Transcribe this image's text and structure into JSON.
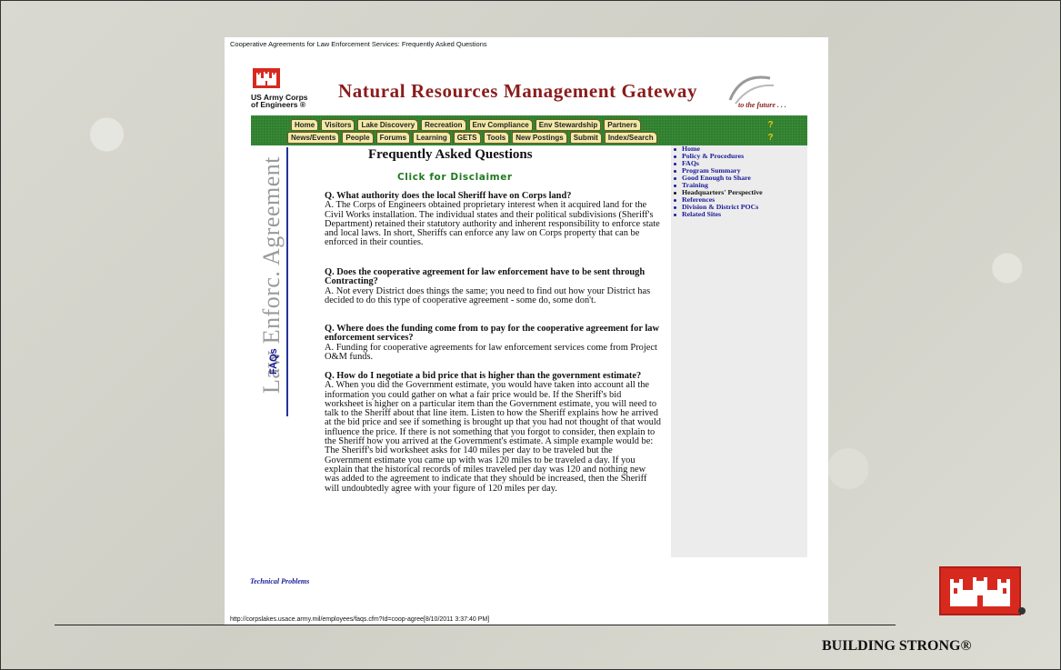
{
  "slide": {
    "footer_text": "BUILDING STRONG®"
  },
  "page": {
    "caption": "Cooperative Agreements for Law Enforcement Services: Frequently Asked Questions",
    "url_line": "http://corpslakes.usace.army.mil/employees/faqs.cfm?Id=coop-agree[8/10/2011 3:37:40 PM]",
    "org_name": "US Army Corps of Engineers ®",
    "site_title": "Natural Resources Management Gateway",
    "tagline": "to the future . . .",
    "nav_row1": [
      "Home",
      "Visitors",
      "Lake Discovery",
      "Recreation",
      "Env Compliance",
      "Env Stewardship",
      "Partners"
    ],
    "nav_row2": [
      "News/Events",
      "People",
      "Forums",
      "Learning",
      "GETS",
      "Tools",
      "New Postings",
      "Submit",
      "Index/Search"
    ],
    "help_glyph": "?",
    "banner_text": "Law Enforc. Agreement",
    "banner_sub": "FAQs",
    "heading": "Frequently Asked Questions",
    "disclaimer": "Click for Disclaimer",
    "faqs": [
      {
        "q": "Q. What authority does the local Sheriff have on Corps land?",
        "a": "A. The Corps of Engineers obtained proprietary interest when it acquired land for the Civil Works installation. The individual states and their political subdivisions (Sheriff's Department) retained their statutory authority and inherent responsibility to enforce state and local laws. In short, Sheriffs can enforce any law on Corps property that can be enforced in their counties."
      },
      {
        "q": "Q. Does the cooperative agreement for law enforcement have to be sent through Contracting?",
        "a": "A. Not every District does things the same; you need to find out how your District has decided to do this type of cooperative agreement - some do, some don't."
      },
      {
        "q": "Q. Where does the funding come from to pay for the cooperative agreement for law enforcement services?",
        "a": "A. Funding for cooperative agreements for law enforcement services come from Project O&M funds."
      },
      {
        "q": "Q. How do I negotiate a bid price that is higher than the government estimate?",
        "a": "A. When you did the Government estimate, you would have taken into account all the information you could gather on what a fair price would be. If the Sheriff's bid worksheet is higher on a particular item than the Government estimate, you will need to talk to the Sheriff about that line item. Listen to how the Sheriff explains how he arrived at the bid price and see if something is brought up that you had not thought of that would influence the price. If there is not something that you forgot to consider, then explain to the Sheriff how you arrived at the Government's estimate. A simple example would be: The Sheriff's bid worksheet asks for 140 miles per day to be traveled but the Government estimate you came up with was 120 miles to be traveled a day. If you explain that the historical records of miles traveled per day was 120 and nothing new was added to the agreement to indicate that they should be increased, then the Sheriff will undoubtedly agree with your figure of 120 miles per day."
      }
    ],
    "technical_problems": "Technical Problems",
    "sidebar": [
      {
        "label": "Home",
        "link": true
      },
      {
        "label": "Policy & Procedures",
        "link": true
      },
      {
        "label": "FAQs",
        "link": true
      },
      {
        "label": "Program Summary",
        "link": true
      },
      {
        "label": "Good Enough to Share",
        "link": true
      },
      {
        "label": "Training",
        "link": true
      },
      {
        "label": "Headquarters' Perspective",
        "link": false
      },
      {
        "label": "References",
        "link": true
      },
      {
        "label": "Division & District POCs",
        "link": true
      },
      {
        "label": "Related Sites",
        "link": true
      }
    ]
  }
}
